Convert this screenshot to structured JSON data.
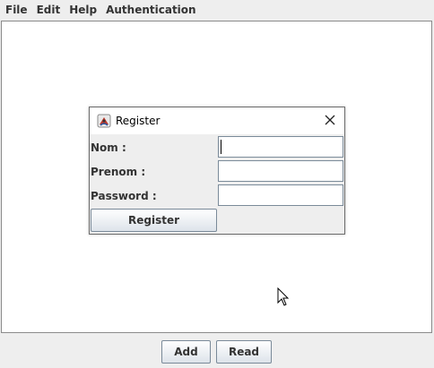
{
  "menu": {
    "items": [
      {
        "label": "File"
      },
      {
        "label": "Edit"
      },
      {
        "label": "Help"
      },
      {
        "label": "Authentication"
      }
    ]
  },
  "dialog": {
    "title": "Register",
    "icon": "java-app-icon",
    "close_icon": "close-icon",
    "fields": {
      "nom": {
        "label": "Nom :",
        "value": "",
        "placeholder": ""
      },
      "prenom": {
        "label": "Prenom :",
        "value": "",
        "placeholder": ""
      },
      "password": {
        "label": "Password :",
        "value": "",
        "placeholder": ""
      }
    },
    "register_label": "Register"
  },
  "bottom": {
    "add_label": "Add",
    "read_label": "Read"
  },
  "colors": {
    "window_bg": "#eeeeee",
    "content_bg": "#ffffff",
    "button_border": "#7a8a99"
  }
}
